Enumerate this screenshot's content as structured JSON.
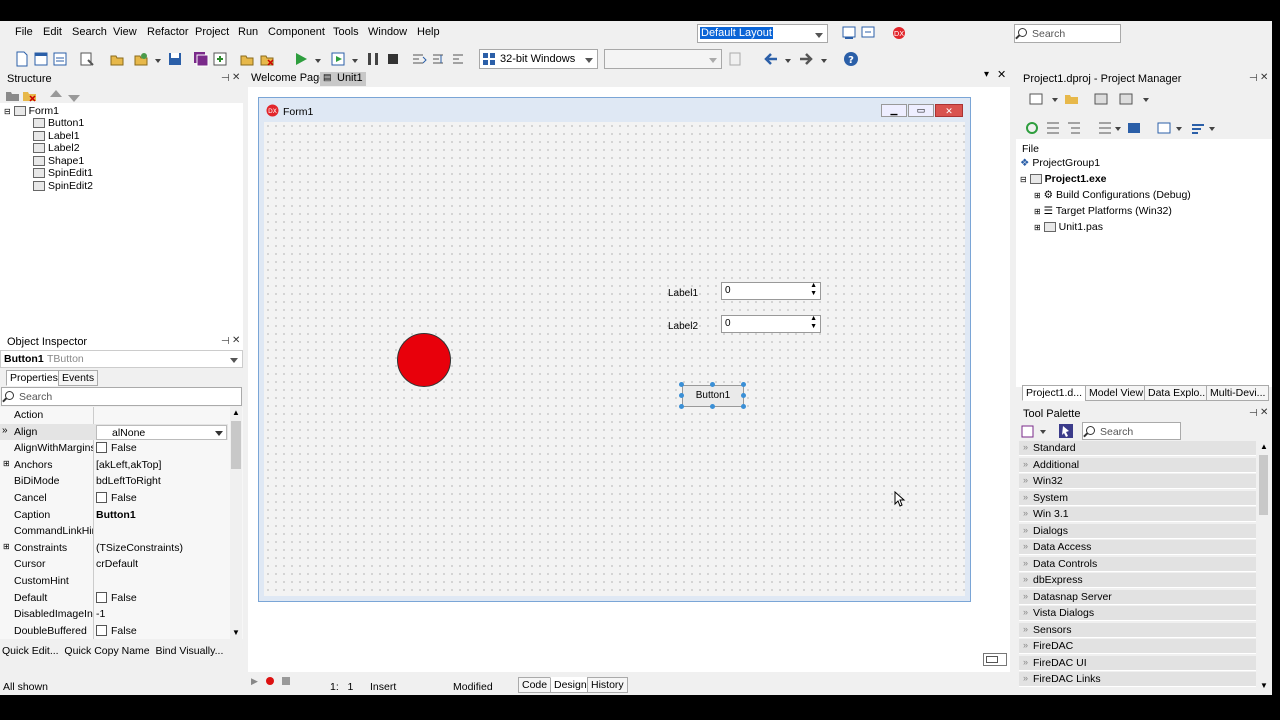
{
  "menu": [
    "File",
    "Edit",
    "Search",
    "View",
    "Refactor",
    "Project",
    "Run",
    "Component",
    "Tools",
    "Window",
    "Help"
  ],
  "layout_combo": "Default Layout",
  "global_search_placeholder": "Search",
  "platform_combo": "32-bit Windows",
  "structure": {
    "title": "Structure",
    "root": "Form1",
    "items": [
      "Button1",
      "Label1",
      "Label2",
      "Shape1",
      "SpinEdit1",
      "SpinEdit2"
    ]
  },
  "object_inspector": {
    "title": "Object Inspector",
    "selected_name": "Button1",
    "selected_type": "TButton",
    "tabs": [
      "Properties",
      "Events"
    ],
    "search_placeholder": "Search",
    "properties": [
      {
        "name": "Action",
        "value": ""
      },
      {
        "name": "Align",
        "value": "alNone"
      },
      {
        "name": "AlignWithMargins",
        "value": "False"
      },
      {
        "name": "Anchors",
        "value": "[akLeft,akTop]"
      },
      {
        "name": "BiDiMode",
        "value": "bdLeftToRight"
      },
      {
        "name": "Cancel",
        "value": "False"
      },
      {
        "name": "Caption",
        "value": "Button1"
      },
      {
        "name": "CommandLinkHint",
        "value": ""
      },
      {
        "name": "Constraints",
        "value": "(TSizeConstraints)"
      },
      {
        "name": "Cursor",
        "value": "crDefault"
      },
      {
        "name": "CustomHint",
        "value": ""
      },
      {
        "name": "Default",
        "value": "False"
      },
      {
        "name": "DisabledImageIndex",
        "value": "-1"
      },
      {
        "name": "DoubleBuffered",
        "value": "False"
      }
    ],
    "links": "Quick Edit...  Quick Copy Name  Bind Visually...",
    "status": "All shown"
  },
  "editor": {
    "tabs": [
      "Welcome Page",
      "Unit1"
    ],
    "form_caption": "Form1",
    "label1": "Label1",
    "label2": "Label2",
    "spin1": "0",
    "spin2": "0",
    "button": "Button1",
    "shape_color": "#e8000b"
  },
  "statusbar": {
    "position": "1:   1",
    "mode": "Insert",
    "modified": "Modified",
    "tabs": [
      "Code",
      "Design",
      "History"
    ]
  },
  "project_manager": {
    "title": "Project1.dproj - Project Manager",
    "file_label": "File",
    "group": "ProjectGroup1",
    "project": "Project1.exe",
    "nodes": [
      "Build Configurations (Debug)",
      "Target Platforms (Win32)",
      "Unit1.pas"
    ],
    "tabs": [
      "Project1.d...",
      "Model View",
      "Data Explo...",
      "Multi-Devi..."
    ]
  },
  "tool_palette": {
    "title": "Tool Palette",
    "search_placeholder": "Search",
    "categories": [
      "Standard",
      "Additional",
      "Win32",
      "System",
      "Win 3.1",
      "Dialogs",
      "Data Access",
      "Data Controls",
      "dbExpress",
      "Datasnap Server",
      "Vista Dialogs",
      "Sensors",
      "FireDAC",
      "FireDAC UI",
      "FireDAC Links"
    ]
  }
}
